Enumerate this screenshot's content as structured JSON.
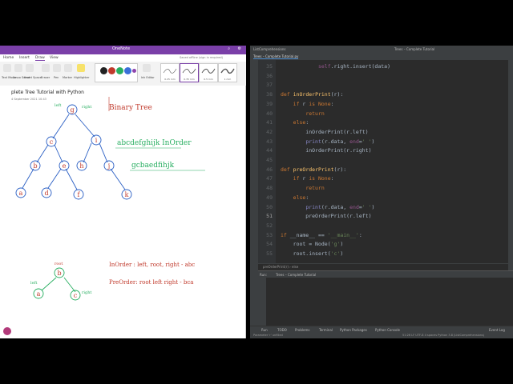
{
  "onenote": {
    "app_title": "OneNote",
    "tabs": [
      "Home",
      "Insert",
      "Draw",
      "View"
    ],
    "ribbon_labels": [
      "Text Mode",
      "Lasso Select",
      "Insert Space",
      "Eraser",
      "Pen",
      "Marker",
      "Highlighter",
      "Ink Editor"
    ],
    "notice": "Saved offline (sign in required)",
    "pen_colors": [
      "#222222",
      "#c0392b",
      "#27ae60",
      "#3a6fd8",
      "#8e44ad"
    ],
    "tiles": [
      "0.25 mm",
      "0.35 mm",
      "0.5 mm",
      "1 mm"
    ],
    "page_title": "plete Tree Tutorial with Python",
    "date": "4 September 2021      10:43",
    "ink": {
      "title": "Binary Tree",
      "inorder_seq": "abcdefghijk InOrder",
      "preorder_seq": "gcbaedfihjk",
      "note_inorder": "InOrder : left, root, right - abc",
      "note_preorder": "PreOrder: root left right - bca",
      "tree_nodes": [
        "g",
        "c",
        "i",
        "b",
        "e",
        "h",
        "j",
        "a",
        "d",
        "f",
        "k"
      ],
      "edge_labels": [
        "left",
        "right"
      ],
      "small_tree": [
        "b",
        "a",
        "c"
      ],
      "small_root_label": "root",
      "small_left_label": "left",
      "small_right_label": "right"
    }
  },
  "pycharm": {
    "title_left": "ListComprehensions",
    "title_mid": "Trees – Complete Tutorial",
    "tab": "Trees – Complete Tutorial.py",
    "code_lines": [
      {
        "n": "35",
        "html": "            self.right.insert(data)"
      },
      {
        "n": "36",
        "html": ""
      },
      {
        "n": "37",
        "html": ""
      },
      {
        "n": "38",
        "html": "def inOrderPrint(r):"
      },
      {
        "n": "39",
        "html": "    if r is None:"
      },
      {
        "n": "40",
        "html": "        return"
      },
      {
        "n": "41",
        "html": "    else:"
      },
      {
        "n": "42",
        "html": "        inOrderPrint(r.left)"
      },
      {
        "n": "43",
        "html": "        print(r.data, end=' ')"
      },
      {
        "n": "44",
        "html": "        inOrderPrint(r.right)"
      },
      {
        "n": "45",
        "html": ""
      },
      {
        "n": "46",
        "html": "def preOrderPrint(r):"
      },
      {
        "n": "47",
        "html": "    if r is None:"
      },
      {
        "n": "48",
        "html": "        return"
      },
      {
        "n": "49",
        "html": "    else:"
      },
      {
        "n": "50",
        "html": "        print(r.data, end=' ')"
      },
      {
        "n": "51",
        "html": "        preOrderPrint(r.left)"
      },
      {
        "n": "52",
        "html": ""
      },
      {
        "n": "53",
        "html": "if __name__ == '__main__':"
      },
      {
        "n": "54",
        "html": "    root = Node('g')"
      },
      {
        "n": "55",
        "html": "    root.insert('c')"
      }
    ],
    "breadcrumb": "preOrderPrint(r)  ›  else",
    "run_label": "Run:",
    "run_tab": "Trees – Complete Tutorial",
    "bottom_tabs": [
      "Run",
      "TODO",
      "Problems",
      "Terminal",
      "Python Packages",
      "Python Console",
      "Event Log"
    ],
    "status_left": "Parameter 'r' unfilled",
    "status_right": "51:26   LF   UTF-8   4 spaces   Python 3.8 (ListComprehensions)"
  }
}
